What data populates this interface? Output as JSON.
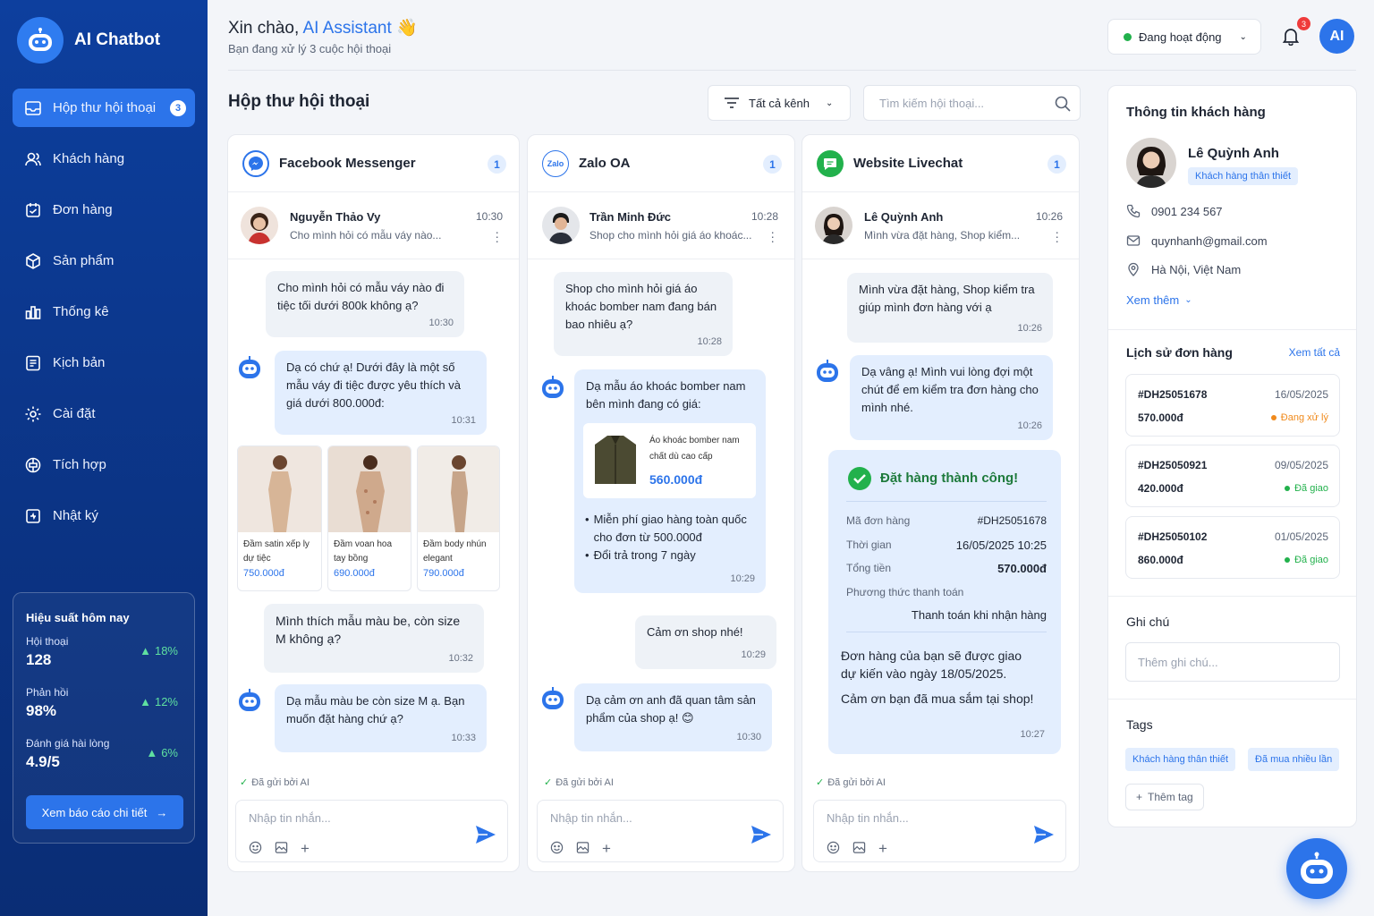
{
  "app": {
    "title": "AI Chatbot"
  },
  "nav": [
    {
      "label": "Hộp thư hội thoại",
      "badge": "3",
      "icon": "inbox-icon"
    },
    {
      "label": "Khách hàng",
      "icon": "users-icon"
    },
    {
      "label": "Đơn hàng",
      "icon": "orders-icon"
    },
    {
      "label": "Sản phẩm",
      "icon": "box-icon"
    },
    {
      "label": "Thống kê",
      "icon": "chart-icon"
    },
    {
      "label": "Kịch bản",
      "icon": "script-icon"
    },
    {
      "label": "Cài đặt",
      "icon": "gear-icon"
    },
    {
      "label": "Tích hợp",
      "icon": "integration-icon"
    },
    {
      "label": "Nhật ký",
      "icon": "log-icon"
    }
  ],
  "performance": {
    "title": "Hiệu suất hôm nay",
    "rows": [
      {
        "label": "Hội thoại",
        "value": "128",
        "delta": "18%"
      },
      {
        "label": "Phản hồi",
        "value": "98%",
        "delta": "12%"
      },
      {
        "label": "Đánh giá hài lòng",
        "value": "4.9/5",
        "delta": "6%"
      }
    ],
    "button": "Xem báo cáo chi tiết"
  },
  "header": {
    "greeting_prefix": "Xin chào,",
    "greeting_name": "AI Assistant",
    "subtitle": "Bạn đang xử lý 3 cuộc hội thoại",
    "status": "Đang hoạt động",
    "notif_count": "3",
    "avatar": "AI"
  },
  "inbox": {
    "title": "Hộp thư hội thoại",
    "filter": "Tất cả kênh",
    "search_placeholder": "Tìm kiếm hội thoại..."
  },
  "columns": {
    "fb": {
      "channel": "Facebook Messenger",
      "count": "1",
      "conv": {
        "name": "Nguyễn Thảo Vy",
        "preview": "Cho mình hỏi có mẫu váy nào...",
        "time": "10:30"
      },
      "msgs": [
        {
          "text": "Cho mình hỏi có mẫu váy nào đi tiệc tối dưới 800k không ạ?",
          "time": "10:30"
        },
        {
          "text": "Dạ có chứ ạ! Dưới đây là một số mẫu váy đi tiệc được yêu thích và giá dưới 800.000đ:",
          "time": "10:31"
        },
        {
          "text": "Mình thích mẫu màu be, còn size M không ạ?",
          "time": "10:32"
        },
        {
          "text": "Dạ mẫu màu be còn size M ạ. Bạn muốn đặt hàng chứ ạ?",
          "time": "10:33"
        }
      ],
      "products": [
        {
          "name": "Đầm satin xếp ly dự tiệc",
          "price": "750.000đ"
        },
        {
          "name": "Đầm voan hoa tay bồng",
          "price": "690.000đ"
        },
        {
          "name": "Đầm body nhún elegant",
          "price": "790.000đ"
        }
      ],
      "sent": "Đã gửi bởi AI",
      "placeholder": "Nhập tin nhắn..."
    },
    "zalo": {
      "channel": "Zalo OA",
      "count": "1",
      "logo": "Zalo",
      "conv": {
        "name": "Trần Minh Đức",
        "preview": "Shop cho mình hỏi giá áo khoác...",
        "time": "10:28"
      },
      "msgs": [
        {
          "text": "Shop cho mình hỏi giá áo khoác bomber nam đang bán bao nhiêu ạ?",
          "time": "10:28"
        },
        {
          "text": "Dạ mẫu áo khoác bomber nam bên mình đang có giá:",
          "time": "10:29"
        },
        {
          "text": "Cảm ơn shop nhé!",
          "time": "10:29"
        },
        {
          "text": "Dạ cảm ơn anh đã quan tâm sản phẩm của shop ạ!",
          "time": "10:30"
        }
      ],
      "product": {
        "name": "Áo khoác bomber nam chất dù cao cấp",
        "price": "560.000đ"
      },
      "bullets": [
        "Miễn phí giao hàng toàn quốc cho đơn từ 500.000đ",
        "Đổi trả trong 7 ngày"
      ],
      "sent": "Đã gửi bởi AI",
      "placeholder": "Nhập tin nhắn..."
    },
    "web": {
      "channel": "Website Livechat",
      "count": "1",
      "conv": {
        "name": "Lê Quỳnh Anh",
        "preview": "Mình vừa đặt hàng, Shop kiểm...",
        "time": "10:26"
      },
      "msgs": [
        {
          "text": "Mình vừa đặt hàng, Shop kiểm tra giúp mình đơn hàng với ạ",
          "time": "10:26"
        },
        {
          "text": "Dạ vâng ạ! Mình vui lòng đợi một chút để em kiểm tra đơn hàng cho mình nhé.",
          "time": "10:26"
        }
      ],
      "success": {
        "title": "Đặt hàng thành công!",
        "rows": [
          {
            "k": "Mã đơn hàng",
            "v": "#DH25051678"
          },
          {
            "k": "Thời gian",
            "v": "16/05/2025 10:25"
          },
          {
            "k": "Tổng tiền",
            "v": "570.000đ"
          }
        ],
        "pay_label": "Phương thức thanh toán",
        "pay_value": "Thanh toán khi nhận hàng",
        "msg1": "Đơn hàng của bạn sẽ được giao dự kiến vào ngày 18/05/2025.",
        "msg2": "Cảm ơn bạn đã mua sắm tại shop!",
        "time": "10:27"
      },
      "sent": "Đã gửi bởi AI",
      "placeholder": "Nhập tin nhắn..."
    }
  },
  "customer": {
    "section_title": "Thông tin khách hàng",
    "name": "Lê Quỳnh Anh",
    "tag": "Khách hàng thân thiết",
    "phone": "0901 234 567",
    "email": "quynhanh@gmail.com",
    "address": "Hà Nội, Việt Nam",
    "more": "Xem thêm"
  },
  "orders": {
    "title": "Lịch sử đơn hàng",
    "view_all": "Xem tất cả",
    "items": [
      {
        "id": "#DH25051678",
        "date": "16/05/2025",
        "amount": "570.000đ",
        "status": "Đang xử lý",
        "color": "#f08a1c"
      },
      {
        "id": "#DH25050921",
        "date": "09/05/2025",
        "amount": "420.000đ",
        "status": "Đã giao",
        "color": "#22b14c"
      },
      {
        "id": "#DH25050102",
        "date": "01/05/2025",
        "amount": "860.000đ",
        "status": "Đã giao",
        "color": "#22b14c"
      }
    ]
  },
  "notes": {
    "title": "Ghi chú",
    "placeholder": "Thêm ghi chú..."
  },
  "tags": {
    "title": "Tags",
    "items": [
      "Khách hàng thân thiết",
      "Đã mua nhiều lần"
    ],
    "add": "Thêm tag"
  },
  "colors": {
    "primary": "#2c74ea",
    "sidebar": "#0b3383",
    "success": "#22b14c",
    "warning": "#f08a1c"
  }
}
